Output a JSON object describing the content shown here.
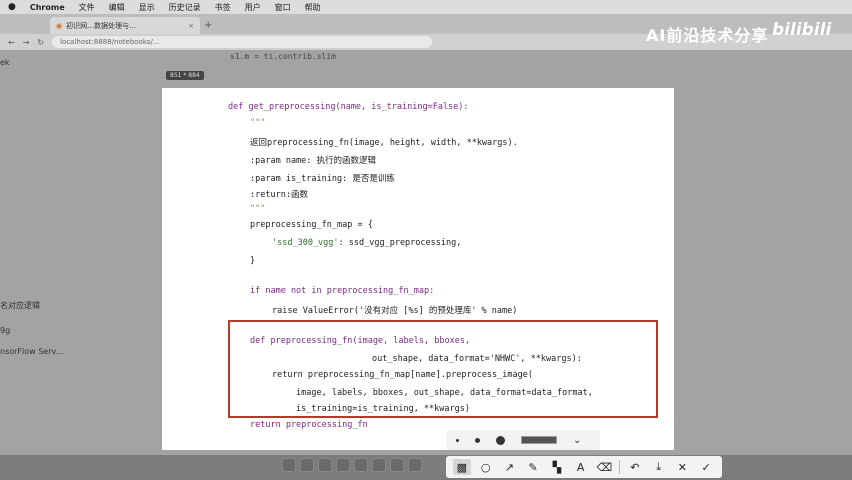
{
  "menubar": {
    "app": "Chrome",
    "items": [
      "文件",
      "编辑",
      "显示",
      "历史记录",
      "书签",
      "用户",
      "窗口",
      "帮助"
    ]
  },
  "tab": {
    "title": "初识网…数据处理与…",
    "close": "×",
    "new": "+"
  },
  "address": {
    "url": "localhost:8888/notebooks/..."
  },
  "background": {
    "top_code": "s1.m = ti.contrib.slim",
    "side_fragment": "ek",
    "side_lines": [
      "名对应逻辑",
      "9g",
      "nsorFlow Serv..."
    ]
  },
  "size_badge": "851 * 884",
  "brand": {
    "text": "AI前沿技术分享",
    "logo": "bilibili"
  },
  "code": {
    "def_line": "def get_preprocessing(name, is_training=False):",
    "doc_open": "\"\"\"",
    "doc_1": "返回preprocessing_fn(image, height, width, **kwargs).",
    "doc_2": ":param name: 执行的函数逻辑",
    "doc_3": ":param is_training: 是否是训练",
    "doc_4": ":return:函数",
    "doc_close": "\"\"\"",
    "map_open": "preprocessing_fn_map = {",
    "map_entry_key": "'ssd_300_vgg'",
    "map_entry_val": ": ssd_vgg_preprocessing,",
    "map_close": "}",
    "if_line": "if name not in preprocessing_fn_map:",
    "raise_line": "raise ValueError('没有对应 [%s] 的预处理库' % name)",
    "def_inner_1": "def preprocessing_fn(image, labels, bboxes,",
    "def_inner_2": "out_shape, data_format='NHWC', **kwargs):",
    "ret_inner_1": "return preprocessing_fn_map[name].preprocess_image(",
    "ret_inner_2": "image, labels, bboxes, out_shape, data_format=data_format,",
    "ret_inner_3": "is_training=is_training, **kwargs)",
    "return_line": "return preprocessing_fn"
  },
  "toolbar_icons": [
    "rectangle-icon",
    "circle-icon",
    "arrow-icon",
    "pen-icon",
    "mosaic-icon",
    "text-icon",
    "eraser-icon",
    "undo-icon",
    "download-icon",
    "close-icon",
    "check-icon"
  ],
  "toolbar_glyphs": {
    "rect": "▩",
    "circle": "○",
    "arrow": "↗",
    "pen": "✎",
    "mosaic": "▚",
    "text": "A",
    "eraser": "⌫",
    "undo": "↶",
    "download": "⤓",
    "close": "✕",
    "check": "✓"
  },
  "option_chevron": "⌄"
}
